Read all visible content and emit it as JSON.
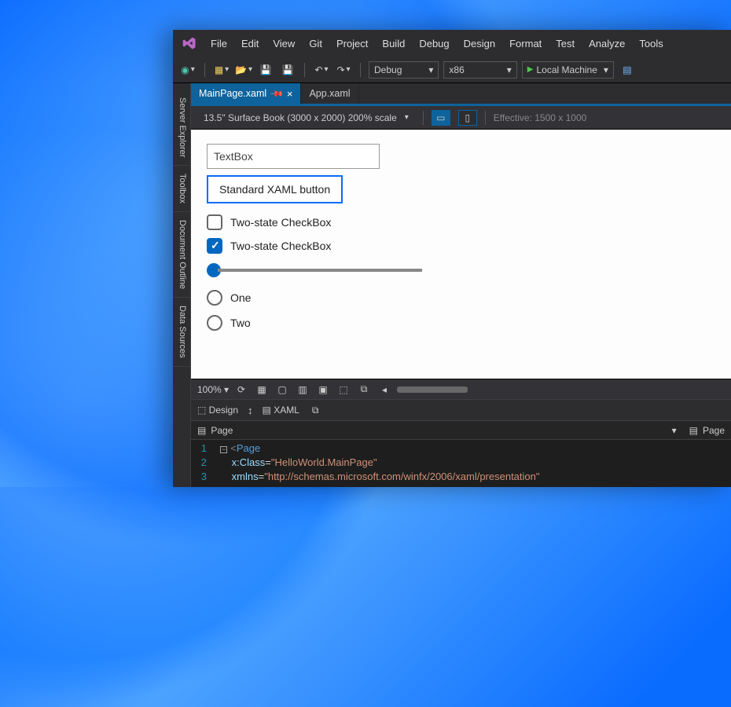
{
  "menu": {
    "items": [
      "File",
      "Edit",
      "View",
      "Git",
      "Project",
      "Build",
      "Debug",
      "Design",
      "Format",
      "Test",
      "Analyze",
      "Tools"
    ]
  },
  "toolbar": {
    "config": "Debug",
    "platform": "x86",
    "run_target": "Local Machine"
  },
  "left_tabs": [
    "Server Explorer",
    "Toolbox",
    "Document Outline",
    "Data Sources"
  ],
  "tabs": [
    {
      "label": "MainPage.xaml",
      "active": true,
      "pinned": true,
      "closeable": true
    },
    {
      "label": "App.xaml",
      "active": false
    }
  ],
  "designer_header": {
    "device": "13.5\" Surface Book (3000 x 2000) 200% scale",
    "effective": "Effective: 1500 x 1000"
  },
  "canvas": {
    "textbox_placeholder": "TextBox",
    "button_label": "Standard XAML button",
    "checkbox1_label": "Two-state CheckBox",
    "checkbox2_label": "Two-state CheckBox",
    "radio1_label": "One",
    "radio2_label": "Two"
  },
  "zoom": {
    "value": "100%"
  },
  "split": {
    "design": "Design",
    "xaml": "XAML"
  },
  "crumb": {
    "left": "Page",
    "right": "Page"
  },
  "code": {
    "lines": [
      {
        "n": "1",
        "pre": "  ",
        "minus": true,
        "tokens": [
          {
            "t": "<",
            "c": "gray"
          },
          {
            "t": "Page",
            "c": "blue"
          }
        ]
      },
      {
        "n": "2",
        "pre": "      ",
        "tokens": [
          {
            "t": "x:Class",
            "c": "lblue"
          },
          {
            "t": "=",
            "c": "d"
          },
          {
            "t": "\"HelloWorld.MainPage\"",
            "c": "str"
          }
        ]
      },
      {
        "n": "3",
        "pre": "      ",
        "tokens": [
          {
            "t": "xmlns",
            "c": "lblue"
          },
          {
            "t": "=",
            "c": "d"
          },
          {
            "t": "\"http://schemas.microsoft.com/winfx/2006/xaml/presentation\"",
            "c": "str"
          }
        ]
      }
    ]
  }
}
